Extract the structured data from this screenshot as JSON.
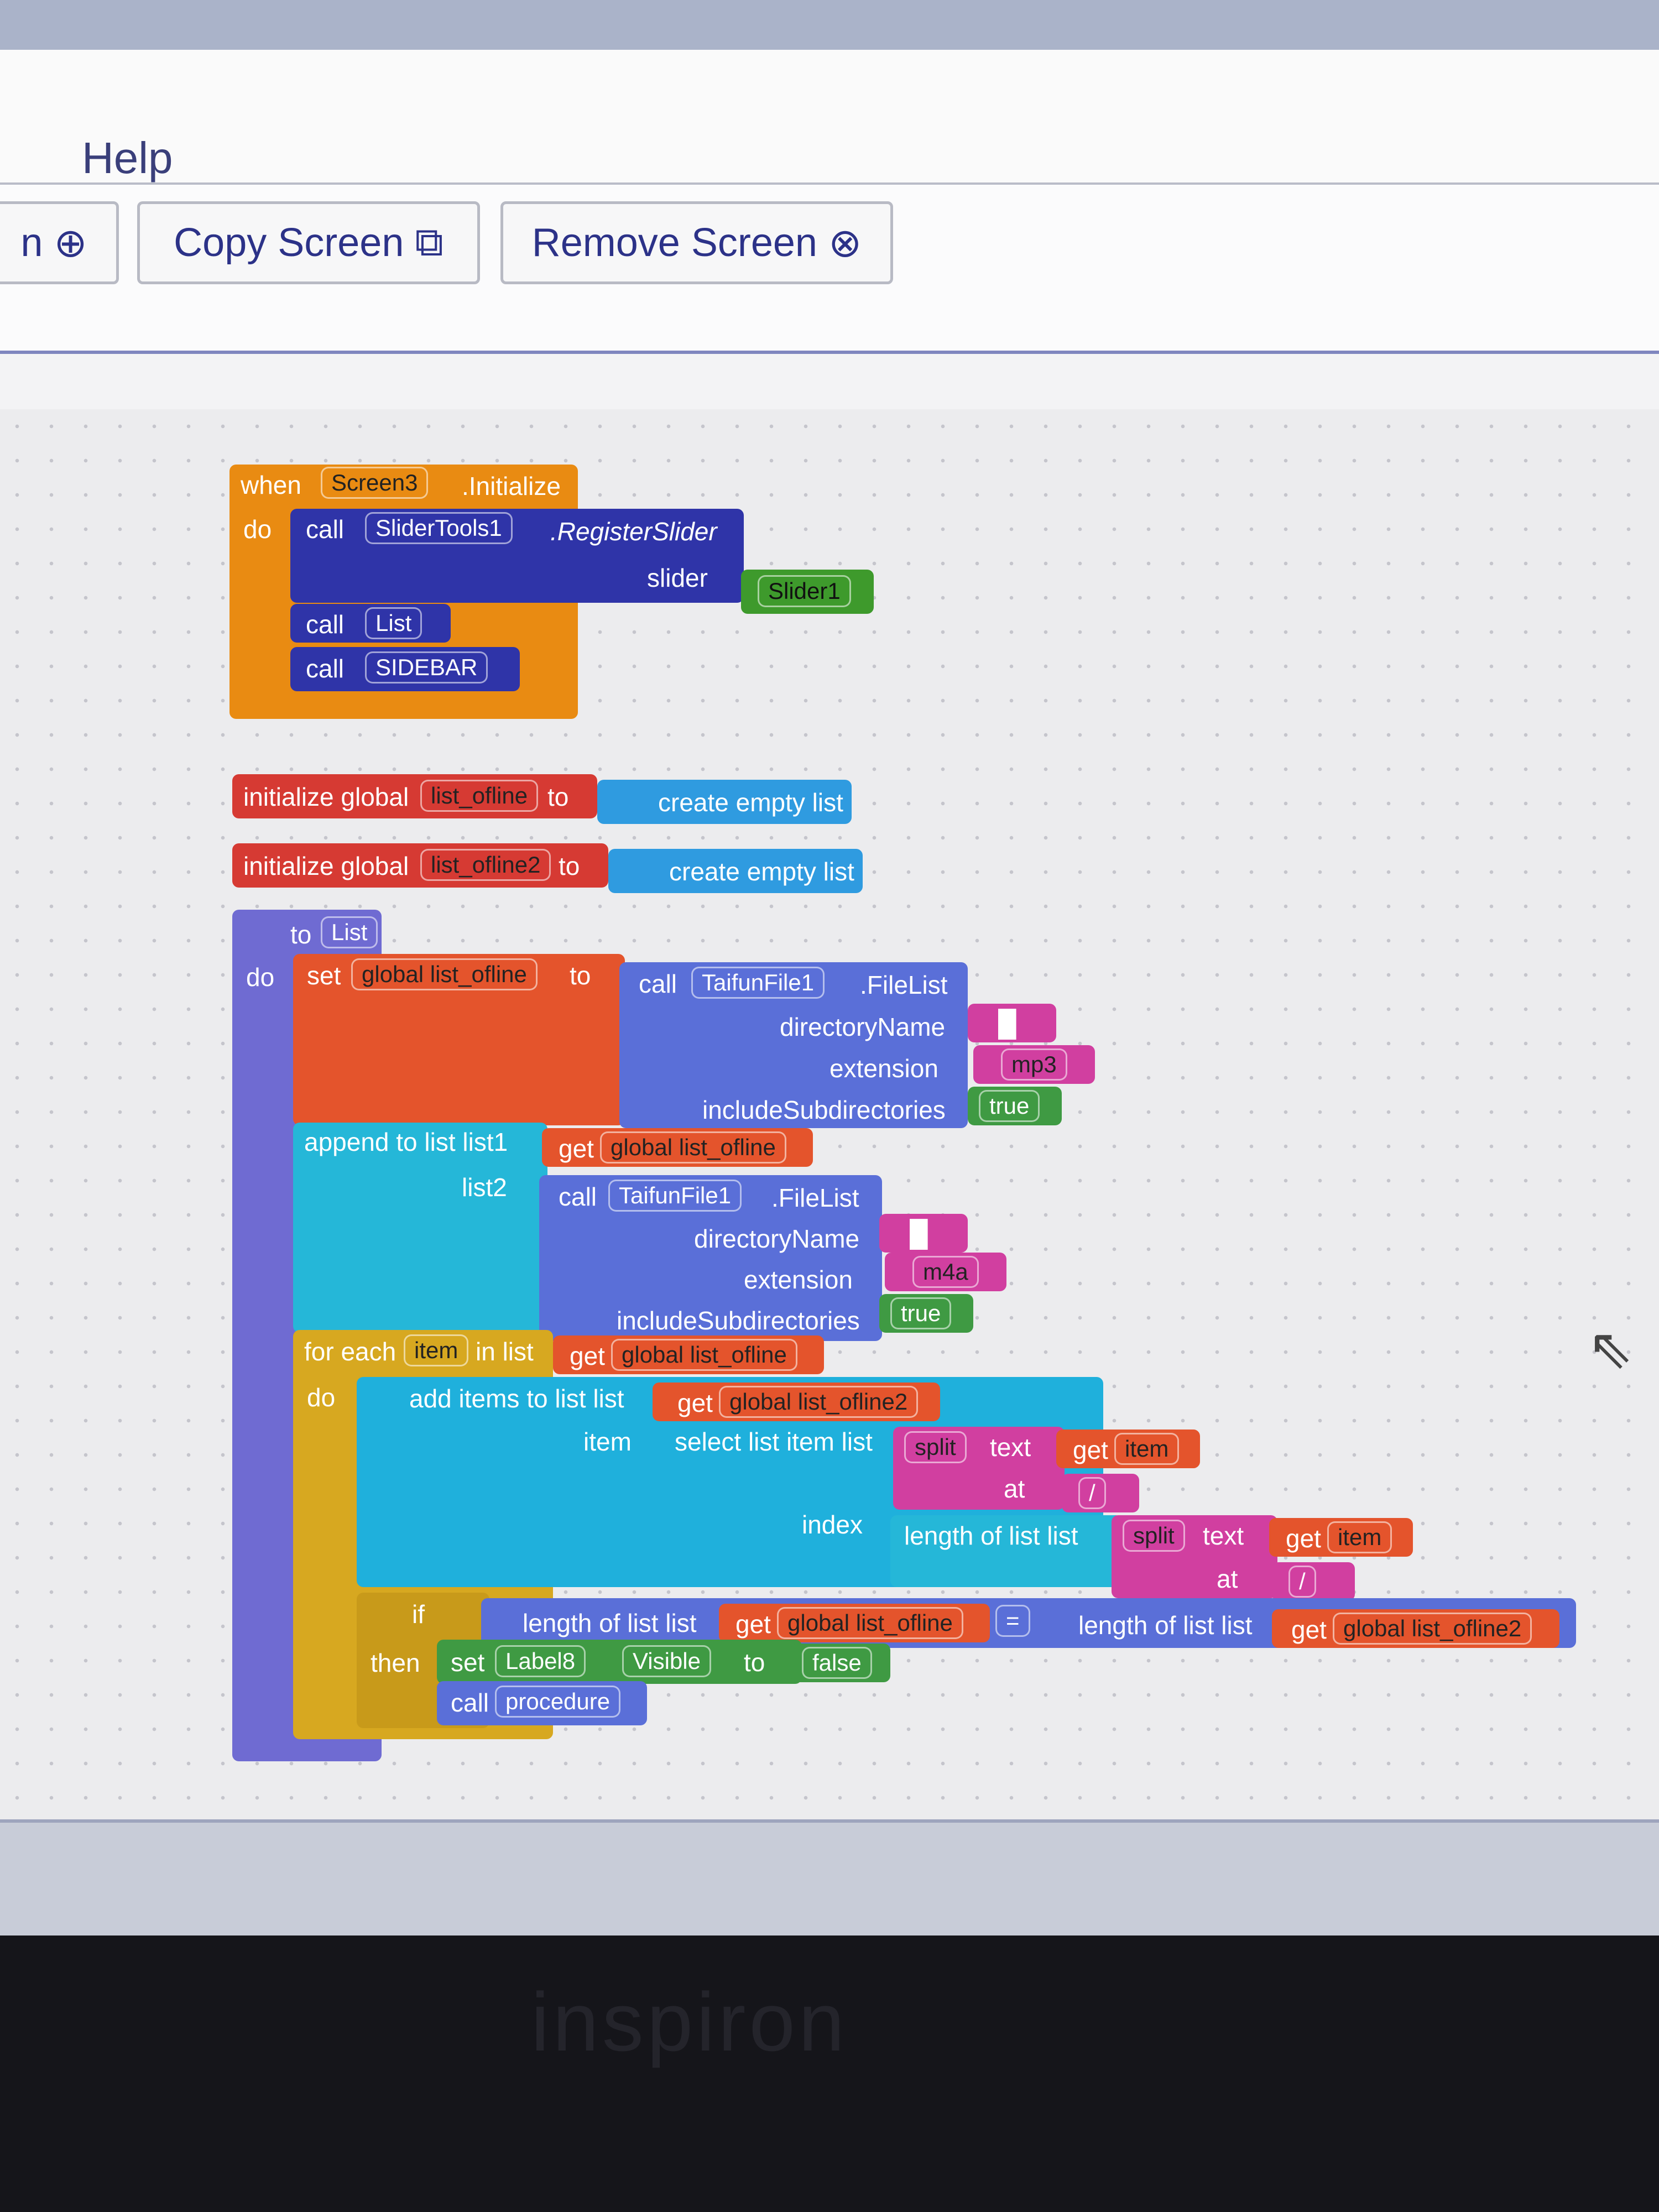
{
  "menu": {
    "help_label": "Help"
  },
  "toolbar": {
    "add_screen_partial": "n",
    "copy_screen_label": "Copy Screen",
    "remove_screen_label": "Remove Screen"
  },
  "blocks": {
    "event": {
      "when": "when",
      "component": "Screen3",
      "event_name": ".Initialize",
      "do": "do"
    },
    "register": {
      "call": "call",
      "component": "SliderTools1",
      "method": ".RegisterSlider",
      "param": "slider",
      "value": "Slider1"
    },
    "call_list": {
      "call": "call",
      "name": "List"
    },
    "call_sidebar": {
      "call": "call",
      "name": "SIDEBAR"
    },
    "global1": {
      "label": "initialize global",
      "name": "list_ofline",
      "to": "to",
      "value": "create empty list"
    },
    "global2": {
      "label": "initialize global",
      "name": "list_ofline2",
      "to": "to",
      "value": "create empty list"
    },
    "proc": {
      "to": "to",
      "name": "List",
      "do": "do"
    },
    "set1": {
      "set": "set",
      "var": "global list_ofline",
      "to": "to",
      "call": "call",
      "component": "TaifunFile1",
      "method": ".FileList",
      "p1": "directoryName",
      "v1": "█",
      "p2": "extension",
      "v2": "mp3",
      "p3": "includeSubdirectories",
      "v3": "true"
    },
    "append": {
      "label": "append to list  list1",
      "get": "get",
      "var": "global list_ofline",
      "list2": "list2",
      "call": "call",
      "component": "TaifunFile1",
      "method": ".FileList",
      "p1": "directoryName",
      "v1": "█",
      "p2": "extension",
      "v2": "m4a",
      "p3": "includeSubdirectories",
      "v3": "true"
    },
    "foreach": {
      "label": "for each",
      "item": "item",
      "in_list": "in list",
      "get": "get",
      "var": "global list_ofline",
      "do": "do"
    },
    "additems": {
      "label": "add items to list   list",
      "get": "get",
      "var": "global list_ofline2",
      "item": "item",
      "select": "select list item  list",
      "split": "split",
      "text": "text",
      "get_item": "get",
      "item_var": "item",
      "at": "at",
      "at_val": "/",
      "index": "index",
      "length": "length of list  list",
      "split2": "split",
      "text2": "text",
      "get2": "get",
      "item2": "item",
      "at2": "at",
      "at_val2": "/"
    },
    "ifblk": {
      "if": "if",
      "length1": "length of list  list",
      "get1": "get",
      "var1": "global list_ofline",
      "op": "=",
      "length2": "length of list  list",
      "get2": "get",
      "var2": "global list_ofline2",
      "then": "then"
    },
    "setlabel": {
      "set": "set",
      "component": "Label8",
      "prop": "Visible",
      "to": "to",
      "value": "false"
    },
    "callproc": {
      "call": "call",
      "name": "procedure"
    }
  },
  "brand": "inspiron",
  "colors": {
    "event": "#e98b12",
    "component": "#2f34a8",
    "global": "#d63a33",
    "list": "#1fb0dc",
    "procedure": "#6f6bd2",
    "control": "#d7a820",
    "text": "#d13fa0",
    "logic": "#3f9a43"
  }
}
